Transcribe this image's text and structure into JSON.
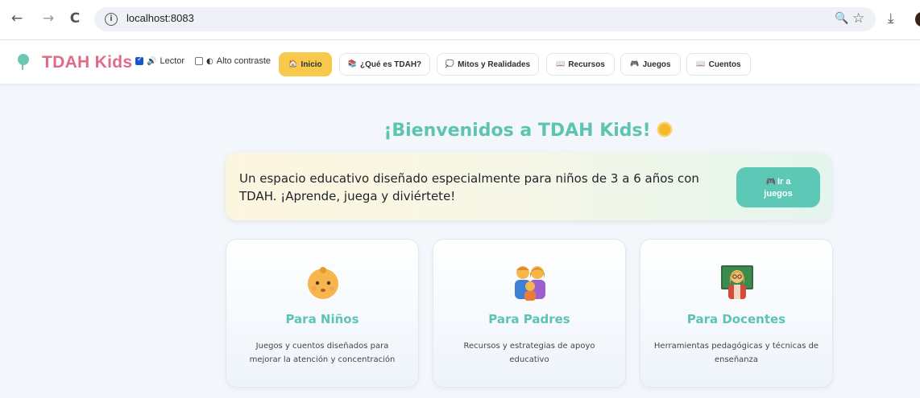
{
  "browser": {
    "url": "localhost:8083",
    "back_icon": "←",
    "forward_icon": "→",
    "reload_icon": "C",
    "info_icon": "i",
    "zoom_icon": "🔍",
    "star_icon": "☆",
    "download_icon": "⤓"
  },
  "header": {
    "brand": "TDAH Kids",
    "reader_label": "Lector",
    "reader_checked": true,
    "contrast_label": "Alto contraste",
    "contrast_checked": false,
    "nav": [
      {
        "label": "Inicio",
        "icon": "🏠",
        "active": true
      },
      {
        "label": "¿Qué es TDAH?",
        "icon": "📚"
      },
      {
        "label": "Mitos y Realidades",
        "icon": "💭"
      },
      {
        "label": "Recursos",
        "icon": "📖"
      },
      {
        "label": "Juegos",
        "icon": "🎮"
      },
      {
        "label": "Cuentos",
        "icon": "📖"
      }
    ]
  },
  "main": {
    "title": "¡Bienvenidos a TDAH Kids!",
    "hero_text": "Un espacio educativo diseñado especialmente para niños de 3 a 6 años con TDAH. ¡Aprende, juega y diviértete!",
    "hero_button_line1": "Ir a",
    "hero_button_line2": "juegos",
    "hero_button_icon": "🎮",
    "cards": [
      {
        "title": "Para Niños",
        "text": "Juegos y cuentos diseñados para mejorar la atención y concentración",
        "icon": "baby-face"
      },
      {
        "title": "Para Padres",
        "text": "Recursos y estrategias de apoyo educativo",
        "icon": "family"
      },
      {
        "title": "Para Docentes",
        "text": "Herramientas pedagógicas y técnicas de enseñanza",
        "icon": "teacher"
      }
    ]
  },
  "colors": {
    "brand_pink": "#e06b89",
    "teal": "#5cc4b0",
    "active_tab": "#f8c94c"
  }
}
